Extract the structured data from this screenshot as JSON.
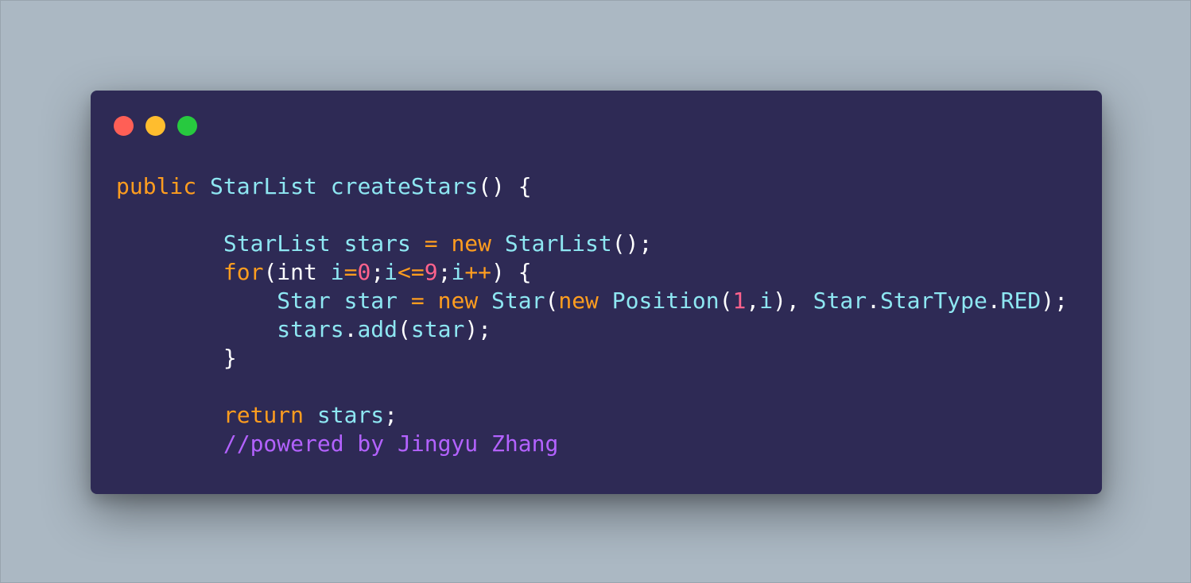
{
  "window": {
    "controls": {
      "close_color": "#ff5f56",
      "minimize_color": "#ffbd2e",
      "maximize_color": "#27c93f"
    }
  },
  "colors": {
    "background": "#abb8c3",
    "editor_background": "#2e2a55",
    "keyword": "#ff9d1f",
    "identifier": "#8ee7f2",
    "number": "#ff628c",
    "comment": "#b362ff"
  },
  "code": {
    "lines": [
      [
        {
          "t": "public",
          "c": "kw"
        },
        {
          "t": " ",
          "c": "pn"
        },
        {
          "t": "StarList",
          "c": "id"
        },
        {
          "t": " ",
          "c": "pn"
        },
        {
          "t": "createStars",
          "c": "id"
        },
        {
          "t": "() {",
          "c": "pn"
        }
      ],
      [],
      [
        {
          "t": "        ",
          "c": "pn"
        },
        {
          "t": "StarList",
          "c": "id"
        },
        {
          "t": " ",
          "c": "pn"
        },
        {
          "t": "stars",
          "c": "id"
        },
        {
          "t": " ",
          "c": "pn"
        },
        {
          "t": "=",
          "c": "kw"
        },
        {
          "t": " ",
          "c": "pn"
        },
        {
          "t": "new",
          "c": "kw"
        },
        {
          "t": " ",
          "c": "pn"
        },
        {
          "t": "StarList",
          "c": "id"
        },
        {
          "t": "();",
          "c": "pn"
        }
      ],
      [
        {
          "t": "        ",
          "c": "pn"
        },
        {
          "t": "for",
          "c": "kw"
        },
        {
          "t": "(int ",
          "c": "pn"
        },
        {
          "t": "i",
          "c": "id"
        },
        {
          "t": "=",
          "c": "kw"
        },
        {
          "t": "0",
          "c": "num"
        },
        {
          "t": ";",
          "c": "pn"
        },
        {
          "t": "i",
          "c": "id"
        },
        {
          "t": "<=",
          "c": "kw"
        },
        {
          "t": "9",
          "c": "num"
        },
        {
          "t": ";",
          "c": "pn"
        },
        {
          "t": "i",
          "c": "id"
        },
        {
          "t": "++",
          "c": "kw"
        },
        {
          "t": ") {",
          "c": "pn"
        }
      ],
      [
        {
          "t": "            ",
          "c": "pn"
        },
        {
          "t": "Star",
          "c": "id"
        },
        {
          "t": " ",
          "c": "pn"
        },
        {
          "t": "star",
          "c": "id"
        },
        {
          "t": " ",
          "c": "pn"
        },
        {
          "t": "=",
          "c": "kw"
        },
        {
          "t": " ",
          "c": "pn"
        },
        {
          "t": "new",
          "c": "kw"
        },
        {
          "t": " ",
          "c": "pn"
        },
        {
          "t": "Star",
          "c": "id"
        },
        {
          "t": "(",
          "c": "pn"
        },
        {
          "t": "new",
          "c": "kw"
        },
        {
          "t": " ",
          "c": "pn"
        },
        {
          "t": "Position",
          "c": "id"
        },
        {
          "t": "(",
          "c": "pn"
        },
        {
          "t": "1",
          "c": "num"
        },
        {
          "t": ",",
          "c": "pn"
        },
        {
          "t": "i",
          "c": "id"
        },
        {
          "t": "), ",
          "c": "pn"
        },
        {
          "t": "Star",
          "c": "id"
        },
        {
          "t": ".",
          "c": "pn"
        },
        {
          "t": "StarType",
          "c": "id"
        },
        {
          "t": ".",
          "c": "pn"
        },
        {
          "t": "RED",
          "c": "id"
        },
        {
          "t": ");",
          "c": "pn"
        }
      ],
      [
        {
          "t": "            ",
          "c": "pn"
        },
        {
          "t": "stars",
          "c": "id"
        },
        {
          "t": ".",
          "c": "pn"
        },
        {
          "t": "add",
          "c": "id"
        },
        {
          "t": "(",
          "c": "pn"
        },
        {
          "t": "star",
          "c": "id"
        },
        {
          "t": ");",
          "c": "pn"
        }
      ],
      [
        {
          "t": "        }",
          "c": "pn"
        }
      ],
      [],
      [
        {
          "t": "        ",
          "c": "pn"
        },
        {
          "t": "return",
          "c": "kw"
        },
        {
          "t": " ",
          "c": "pn"
        },
        {
          "t": "stars",
          "c": "id"
        },
        {
          "t": ";",
          "c": "pn"
        }
      ],
      [
        {
          "t": "        ",
          "c": "pn"
        },
        {
          "t": "//powered by Jingyu Zhang",
          "c": "cm"
        }
      ]
    ]
  }
}
